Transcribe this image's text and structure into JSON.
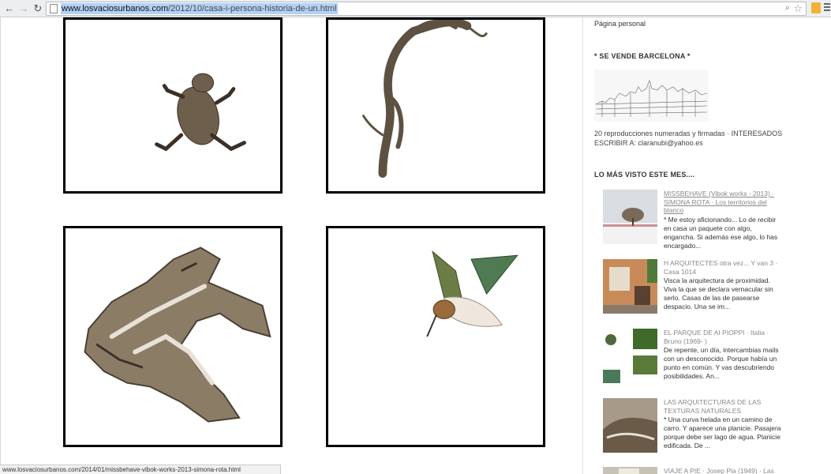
{
  "browser": {
    "url_host": "www.losvaciosurbanos.com",
    "url_path": "/2012/10/casa-i-persona-historia-de-un.html",
    "back_glyph": "←",
    "forward_glyph": "→",
    "reload_glyph": "↻",
    "zoom_glyph": "⌕",
    "star_glyph": "☆"
  },
  "sidebar": {
    "personal_link": "Página personal",
    "sale_heading": "* SE VENDE BARCELONA *",
    "sale_text": "20 reproducciones numeradas y firmadas · INTERESADOS ESCRIBIR A: claranubi@yahoo.es",
    "popular_heading": "LO MÁS VISTO ESTE MES....",
    "posts": [
      {
        "title": "MISSBEHAVE (Vibok works - 2013) · SIMONA ROTA · Los territorios del blanco",
        "excerpt": "* Me estoy aficionando... Lo de recibir en casa un paquete con algo, engancha. Si además ese algo, lo has encargado..."
      },
      {
        "title": "H ARQUITECTES otra vez... Y van 3 · Casa 1014",
        "excerpt": "Visca la arquitectura de proximidad. Viva la que se declara vernacular sin serlo. Casas de las de pasearse despacio. Una se im..."
      },
      {
        "title": "EL PARQUE DE AI PIOPPI · Italia · Bruno (1969- )",
        "excerpt": "De repente, un día, intercambias mails con un desconocido. Porque había un punto en común. Y vas descubriendo posibilidades. An..."
      },
      {
        "title": "LAS ARQUITECTURAS DE LAS TEXTURAS NATURALES",
        "excerpt": "* Una curva helada en un camino de carro. Y aparece una planicie. Pasajera porque debe ser lago de agua. Planicie edificada. De ..."
      },
      {
        "title": "VIAJE A PIE · Josep Pla (1949) · Las"
      }
    ]
  },
  "status_bar": {
    "url": "www.losvaciosurbanos.com/2014/01/missbehave-vibok-works-2013-simona-rota.html"
  }
}
